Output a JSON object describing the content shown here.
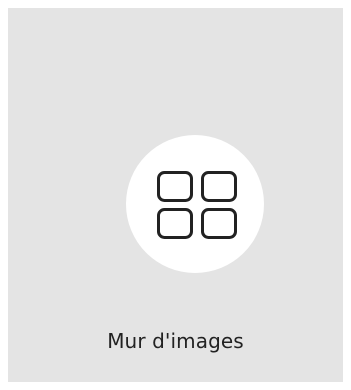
{
  "tile": {
    "label": "Mur d'images",
    "icon": "grid-2x2-icon"
  },
  "colors": {
    "page_background": "#ffffff",
    "tile_background": "#e4e4e4",
    "circle_fill": "#ffffff",
    "icon_stroke": "#222222",
    "label_text": "#222222"
  }
}
